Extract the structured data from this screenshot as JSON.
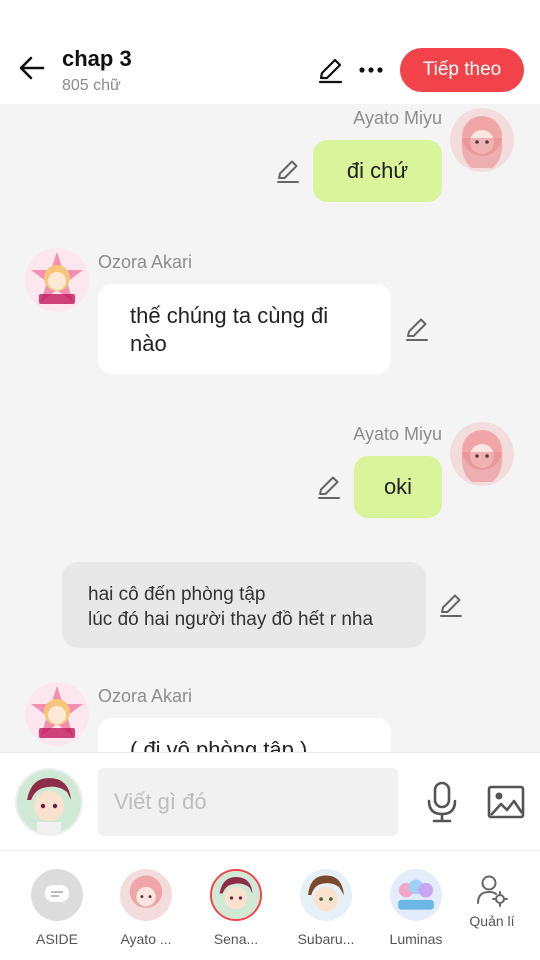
{
  "header": {
    "title": "chap 3",
    "word_count": "805 chữ",
    "next_label": "Tiếp theo",
    "accent_color": "#f2434a"
  },
  "messages": [
    {
      "type": "right",
      "sender": "Ayato  Miyu",
      "text": "đi chứ"
    },
    {
      "type": "left",
      "sender": "Ozora Akari",
      "text": "thế chúng ta cùng đi nào"
    },
    {
      "type": "right",
      "sender": "Ayato  Miyu",
      "text": "oki"
    },
    {
      "type": "narration",
      "lines": [
        "hai cô đến phòng tập",
        "lúc đó hai người thay đồ hết r nha"
      ]
    },
    {
      "type": "left",
      "sender": "Ozora Akari",
      "text": "( đi vô phòng tập )"
    }
  ],
  "composer": {
    "placeholder": "Viết gì đó"
  },
  "bottom_bar": {
    "items": [
      {
        "label": "ASIDE",
        "icon": "aside-icon"
      },
      {
        "label": "Ayato ...",
        "icon": "avatar"
      },
      {
        "label": "Sena...",
        "icon": "avatar"
      },
      {
        "label": "Subaru...",
        "icon": "avatar"
      },
      {
        "label": "Luminas",
        "icon": "avatar"
      },
      {
        "label": "Quản lí",
        "icon": "manage-user-icon"
      }
    ]
  },
  "colors": {
    "bubble_right": "#d9f49b",
    "bubble_left": "#ffffff",
    "narration": "#e8e8e8"
  }
}
